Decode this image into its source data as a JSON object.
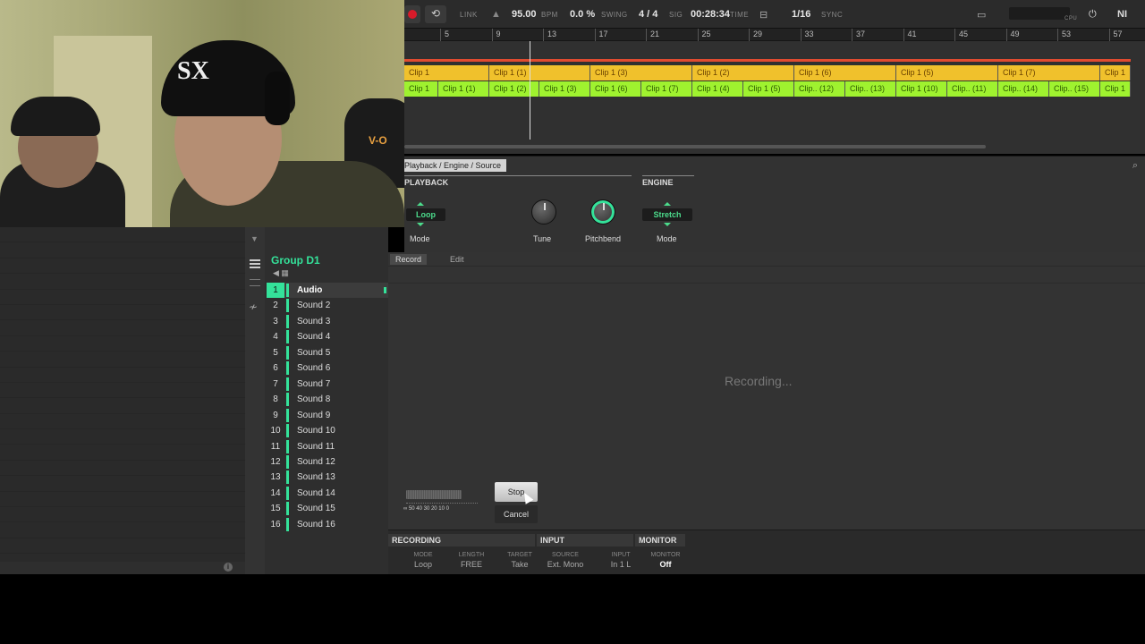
{
  "transport": {
    "link": "LINK",
    "bpm_value": "95.00",
    "bpm_label": "BPM",
    "swing_value": "0.0 %",
    "swing_label": "SWING",
    "sig_value": "4 / 4",
    "sig_label": "SIG",
    "time_value": "00:28:34",
    "time_label": "TIME",
    "quant_value": "1/16",
    "sync_label": "SYNC",
    "cpu_label": "CPU",
    "brand": "NI"
  },
  "ruler": {
    "ticks": [
      "5",
      "9",
      "13",
      "17",
      "21",
      "25",
      "29",
      "33",
      "37",
      "41",
      "45",
      "49",
      "53",
      "57"
    ]
  },
  "arranger": {
    "orange_clips": [
      "Clip 1",
      "Clip 1 (1)",
      "Clip 1 (3)",
      "Clip 1 (2)",
      "Clip 1 (6)",
      "Clip 1 (5)",
      "Clip 1 (7)",
      "Clip 1"
    ],
    "green_clips": [
      "Clip 1",
      "Clip 1 (1)",
      "Clip 1 (2)",
      "Clip 1 (3)",
      "Clip 1 (6)",
      "Clip 1 (7)",
      "Clip 1 (4)",
      "Clip 1 (5)",
      "Clip.. (12)",
      "Clip.. (13)",
      "Clip 1 (10)",
      "Clip.. (11)",
      "Clip.. (14)",
      "Clip.. (15)",
      "Clip 1"
    ]
  },
  "properties": {
    "breadcrumb": "Playback / Engine / Source",
    "playback_title": "PLAYBACK",
    "engine_title": "ENGINE",
    "loop_value": "Loop",
    "mode_label": "Mode",
    "tune_label": "Tune",
    "pitchbend_label": "Pitchbend",
    "stretch_value": "Stretch",
    "engine_mode_label": "Mode"
  },
  "group": {
    "name": "Group D1",
    "sounds": [
      {
        "num": "1",
        "name": "Audio"
      },
      {
        "num": "2",
        "name": "Sound 2"
      },
      {
        "num": "3",
        "name": "Sound 3"
      },
      {
        "num": "4",
        "name": "Sound 4"
      },
      {
        "num": "5",
        "name": "Sound 5"
      },
      {
        "num": "6",
        "name": "Sound 6"
      },
      {
        "num": "7",
        "name": "Sound 7"
      },
      {
        "num": "8",
        "name": "Sound 8"
      },
      {
        "num": "9",
        "name": "Sound 9"
      },
      {
        "num": "10",
        "name": "Sound 10"
      },
      {
        "num": "11",
        "name": "Sound 11"
      },
      {
        "num": "12",
        "name": "Sound 12"
      },
      {
        "num": "13",
        "name": "Sound 13"
      },
      {
        "num": "14",
        "name": "Sound 14"
      },
      {
        "num": "15",
        "name": "Sound 15"
      },
      {
        "num": "16",
        "name": "Sound 16"
      }
    ]
  },
  "sampler": {
    "tab_record": "Record",
    "tab_edit": "Edit",
    "status": "Recording...",
    "meter_scale": "∞  50  40  30  20  10  0",
    "stop_label": "Stop",
    "cancel_label": "Cancel"
  },
  "settings": {
    "recording_title": "RECORDING",
    "input_title": "INPUT",
    "monitor_title": "MONITOR",
    "mode_k": "MODE",
    "mode_v": "Loop",
    "length_k": "LENGTH",
    "length_v": "FREE",
    "target_k": "TARGET",
    "target_v": "Take",
    "source_k": "SOURCE",
    "source_v": "Ext. Mono",
    "input_k": "INPUT",
    "input_v": "In 1 L",
    "monitor_k": "MONITOR",
    "monitor_v": "Off"
  },
  "colors": {
    "accent": "#34e29a",
    "orange_clip": "#f0c12c",
    "green_clip": "#9ff22f",
    "record": "#d81b2a"
  }
}
